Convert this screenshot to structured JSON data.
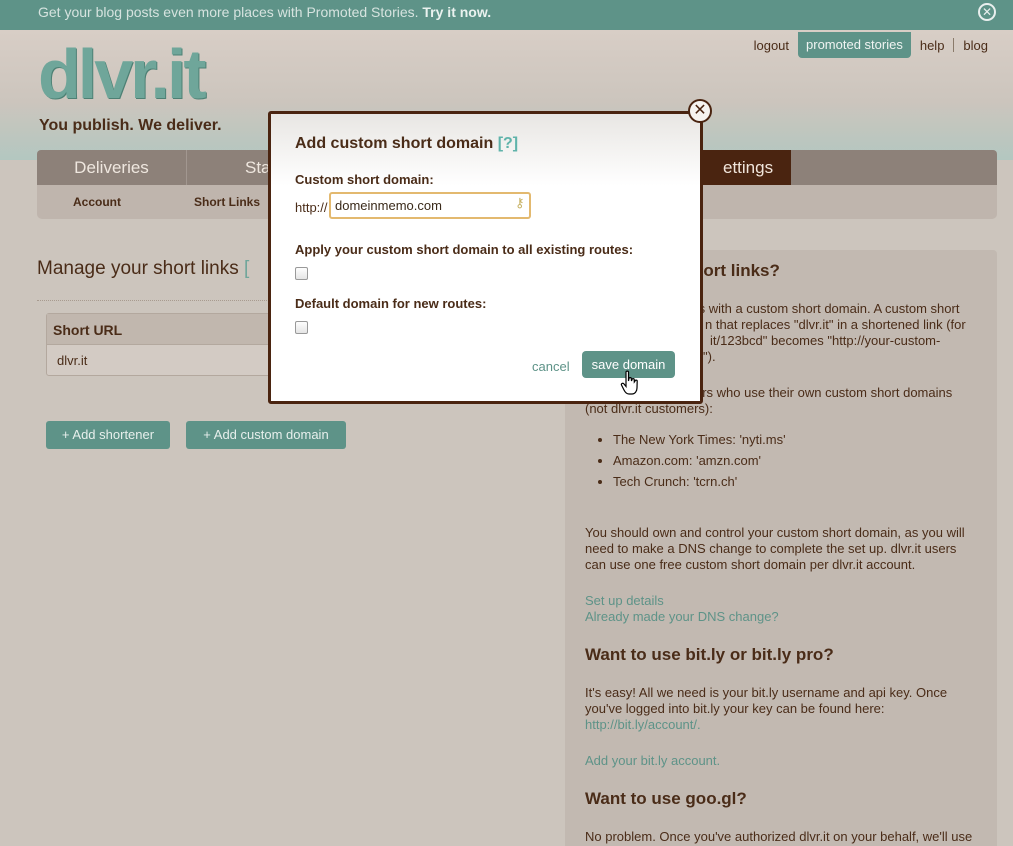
{
  "promo": {
    "text": "Get your blog posts even more places with Promoted Stories.",
    "cta": "Try it now."
  },
  "brand": {
    "logo": "dlvr.it",
    "tagline": "You publish. We deliver."
  },
  "top_nav": {
    "logout": "logout",
    "promoted": "promoted stories",
    "help": "help",
    "blog": "blog"
  },
  "main_tabs": {
    "deliveries": "Deliveries",
    "stats": "Sta",
    "settings": "ettings"
  },
  "sub_tabs": {
    "account": "Account",
    "short_links": "Short Links"
  },
  "manage": {
    "title": "Manage your short links",
    "help": "[",
    "table_header": "Short URL",
    "row": "dlvr.it",
    "add_shortener": "+ Add shortener",
    "add_custom": "+ Add custom domain"
  },
  "side": {
    "h1": "hort links?",
    "p1a": "ts with a custom short domain. A custom short",
    "p1b": "n that replaces \"dlvr.it\" in a shortened link (for",
    "p1c": "it/123bcd\" becomes \"http://your-custom-",
    "p1d": "\").",
    "p2a": "ers who use their own custom short domains",
    "p2b": "(not dlvr.it customers):",
    "list": [
      "The New York Times: 'nyti.ms'",
      "Amazon.com: 'amzn.com'",
      "Tech Crunch: 'tcrn.ch'"
    ],
    "p3": "You should own and control your custom short domain, as you will need to make a DNS change to complete the set up. dlvr.it users can use one free custom short domain per dlvr.it account.",
    "setup": "Set up details",
    "dns": "Already made your DNS change?",
    "h2": "Want to use bit.ly or bit.ly pro?",
    "p4": "It's easy! All we need is your bit.ly username and api key. Once you've logged into bit.ly your key can be found here:",
    "bitly_link": "http://bit.ly/account/.",
    "add_bitly": "Add your bit.ly account.",
    "h3": "Want to use goo.gl?",
    "p5": "No problem. Once you've authorized dlvr.it on your behalf, we'll use"
  },
  "modal": {
    "title": "Add custom short domain",
    "help": "[?]",
    "label_domain": "Custom short domain:",
    "prefix": "http://",
    "domain_value": "domeinmemo.com",
    "label_apply": "Apply your custom short domain to all existing routes:",
    "label_default": "Default domain for new routes:",
    "cancel": "cancel",
    "save": "save domain",
    "close": "✕"
  }
}
